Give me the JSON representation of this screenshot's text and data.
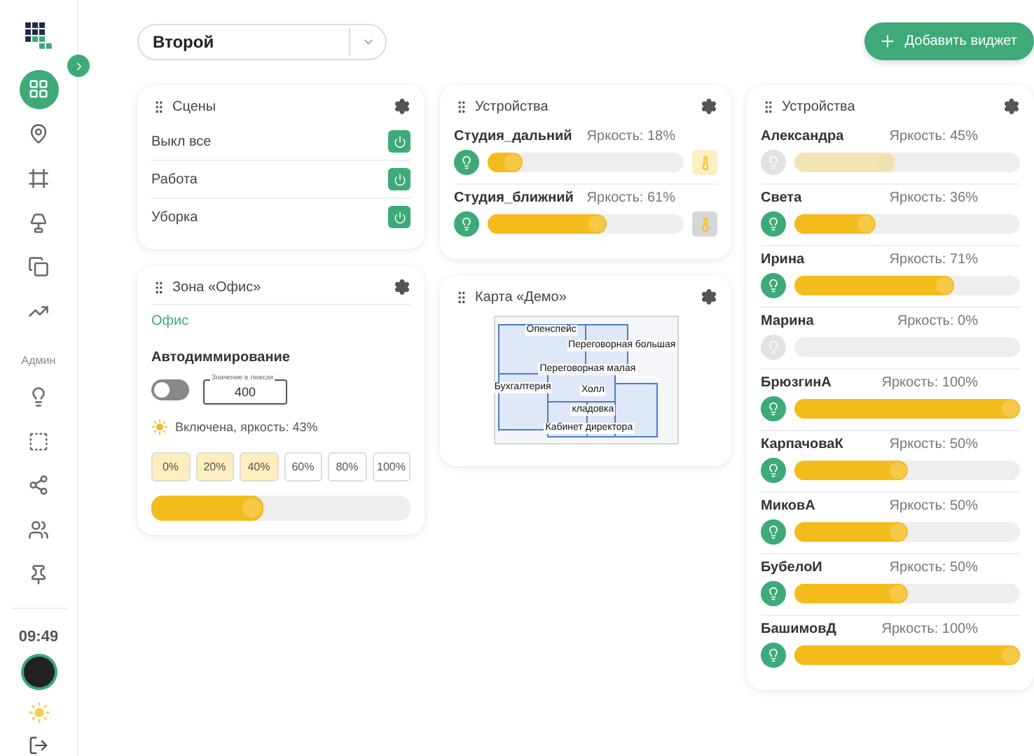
{
  "sidebar": {
    "nav": [
      {
        "selected": true
      },
      {
        "selected": false
      },
      {
        "selected": false
      },
      {
        "selected": false
      },
      {
        "selected": false
      },
      {
        "selected": false
      }
    ],
    "section_label": "Админ",
    "admin_nav": [
      {
        "selected": false
      },
      {
        "selected": false
      },
      {
        "selected": false
      },
      {
        "selected": false
      },
      {
        "selected": false
      }
    ],
    "time": "09:49"
  },
  "header": {
    "view_select": {
      "value": "Второй"
    },
    "add_button": {
      "label": "Добавить виджет"
    }
  },
  "scenes_card": {
    "title": "Сцены",
    "scenes": [
      {
        "label": "Выкл все"
      },
      {
        "label": "Работа"
      },
      {
        "label": "Уборка"
      }
    ]
  },
  "zone_card": {
    "title": "Зона «Офис»",
    "zone_link": "Офис",
    "auto_dim": {
      "label": "Автодиммирование",
      "on": false,
      "lux_field": {
        "label": "Значение в люксах",
        "value": "400"
      }
    },
    "status": "Включена, яркость: 43%",
    "presets": [
      {
        "label": "0%",
        "active": true
      },
      {
        "label": "20%",
        "active": true
      },
      {
        "label": "40%",
        "active": true
      },
      {
        "label": "60%",
        "active": false
      },
      {
        "label": "80%",
        "active": false
      },
      {
        "label": "100%",
        "active": false
      }
    ],
    "level": 0.43
  },
  "devices_card": {
    "title": "Устройства",
    "devices": [
      {
        "name": "Студия_дальний",
        "reading": "Яркость: 18%",
        "on": true,
        "level": 0.18,
        "color": "#fcefc4"
      },
      {
        "name": "Студия_ближний",
        "reading": "Яркость: 61%",
        "on": true,
        "level": 0.61,
        "color": "#d6d6d6"
      }
    ]
  },
  "map_card": {
    "title": "Карта «Демо»",
    "labels": [
      "Опенспейс",
      "Переговорная большая",
      "Переговорная малая",
      "Бухгалтерия",
      "Холл",
      "кладовка",
      "Кабинет директора"
    ]
  },
  "devices_card_2": {
    "title": "Устройства",
    "devices": [
      {
        "name": "Александра",
        "reading": "Яркость: 45%",
        "on": false,
        "level": 0.45
      },
      {
        "name": "Света",
        "reading": "Яркость: 36%",
        "on": true,
        "level": 0.36
      },
      {
        "name": "Ирина",
        "reading": "Яркость: 71%",
        "on": true,
        "level": 0.71
      },
      {
        "name": "Марина",
        "reading": "Яркость: 0%",
        "on": false,
        "level": 0
      },
      {
        "name": "БрюзгинА",
        "reading": "Яркость: 100%",
        "on": true,
        "level": 1
      },
      {
        "name": "КарпачоваК",
        "reading": "Яркость: 50%",
        "on": true,
        "level": 0.5
      },
      {
        "name": "МиковА",
        "reading": "Яркость: 50%",
        "on": true,
        "level": 0.5
      },
      {
        "name": "БубелоИ",
        "reading": "Яркость: 50%",
        "on": true,
        "level": 0.5
      },
      {
        "name": "БашимовД",
        "reading": "Яркость: 100%",
        "on": true,
        "level": 1
      }
    ]
  }
}
